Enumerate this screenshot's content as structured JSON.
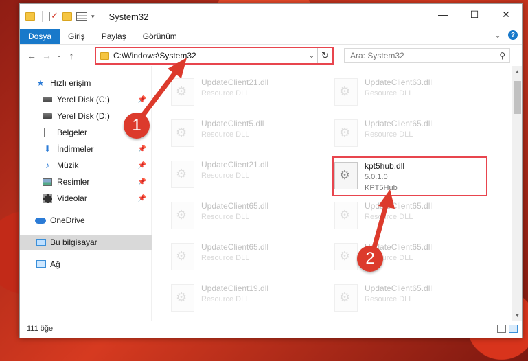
{
  "window": {
    "title": "System32"
  },
  "ribbon": {
    "tabs": [
      "Dosya",
      "Giriş",
      "Paylaş",
      "Görünüm"
    ]
  },
  "address": {
    "path": "C:\\Windows\\System32",
    "search_placeholder": "Ara: System32"
  },
  "nav": {
    "items": [
      {
        "label": "Hızlı erişim",
        "icon": "star-icon",
        "pinned": false
      },
      {
        "label": "Yerel Disk (C:)",
        "icon": "drive-icon",
        "pinned": true
      },
      {
        "label": "Yerel Disk (D:)",
        "icon": "drive-icon",
        "pinned": true
      },
      {
        "label": "Belgeler",
        "icon": "document-icon",
        "pinned": true
      },
      {
        "label": "İndirmeler",
        "icon": "download-icon",
        "pinned": true
      },
      {
        "label": "Müzik",
        "icon": "music-icon",
        "pinned": true
      },
      {
        "label": "Resimler",
        "icon": "pictures-icon",
        "pinned": true
      },
      {
        "label": "Videolar",
        "icon": "video-icon",
        "pinned": true
      },
      {
        "label": "OneDrive",
        "icon": "cloud-icon",
        "pinned": false
      },
      {
        "label": "Bu bilgisayar",
        "icon": "computer-icon",
        "pinned": false
      },
      {
        "label": "Ağ",
        "icon": "network-icon",
        "pinned": false
      }
    ]
  },
  "files": {
    "left": [
      {
        "name": "UpdateClient21.dll",
        "meta": "Resource DLL"
      },
      {
        "name": "UpdateClient5.dll",
        "meta": "Resource DLL"
      },
      {
        "name": "UpdateClient21.dll",
        "meta": "Resource DLL"
      },
      {
        "name": "UpdateClient65.dll",
        "meta": "Resource DLL"
      },
      {
        "name": "UpdateClient65.dll",
        "meta": "Resource DLL"
      },
      {
        "name": "UpdateClient19.dll",
        "meta": "Resource DLL"
      }
    ],
    "right": [
      {
        "name": "UpdateClient63.dll",
        "meta": "Resource DLL"
      },
      {
        "name": "UpdateClient65.dll",
        "meta": "Resource DLL"
      },
      {
        "name": "kpt5hub.dll",
        "meta": "5.0.1.0",
        "meta2": "KPT5Hub"
      },
      {
        "name": "UpdateClient65.dll",
        "meta": "Resource DLL"
      },
      {
        "name": "UpdateClient65.dll",
        "meta": "Resource DLL"
      },
      {
        "name": "UpdateClient65.dll",
        "meta": "Resource DLL"
      }
    ]
  },
  "status": {
    "count": "111 öğe"
  },
  "annotations": {
    "step1": "1",
    "step2": "2"
  },
  "colors": {
    "highlight": "#e8454e",
    "badge": "#dc3a2c",
    "accent": "#1979ca"
  }
}
